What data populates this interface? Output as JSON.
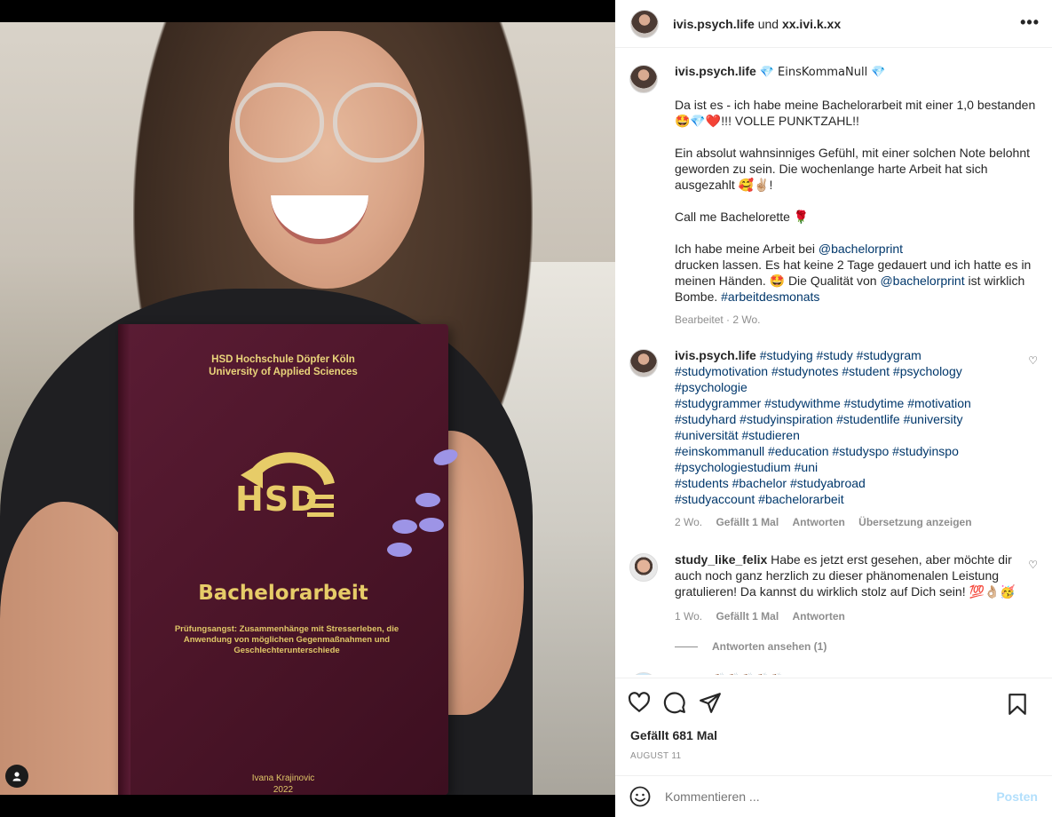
{
  "photo": {
    "book": {
      "university": "HSD Hochschule Döpfer Köln",
      "university_sub": "University of Applied Sciences",
      "logo_text": "HSD",
      "title": "Bachelorarbeit",
      "topic": "Prüfungsangst: Zusammenhänge mit Stresserleben, die Anwendung von möglichen Gegenmaßnahmen und Geschlechterunterschiede",
      "author": "Ivana Krajinovic",
      "year": "2022"
    }
  },
  "header": {
    "username": "ivis.psych.life",
    "connector": "und",
    "collaborator": "xx.ivi.k.xx",
    "more_label": "•••"
  },
  "caption": {
    "username": "ivis.psych.life",
    "title": "💎 EinsKommaNull 💎",
    "p1": "Da ist es - ich habe meine Bachelorarbeit mit einer 1,0 bestanden 🤩💎❤️!!! VOLLE PUNKTZAHL!!",
    "p2": "Ein absolut wahnsinniges Gefühl, mit einer solchen Note belohnt geworden zu sein. Die wochenlange harte Arbeit hat sich ausgezahlt 🥰✌🏼!",
    "p3": "Call me Bachelorette 🌹",
    "p4_a": "Ich habe meine Arbeit bei",
    "p4_mention1": "@bachelorprint",
    "p4_b": "drucken lassen. Es hat keine 2 Tage gedauert und ich hatte es in meinen Händen. 🤩 Die Qualität von",
    "p4_mention2": "@bachelorprint",
    "p4_c": "ist wirklich Bombe.",
    "p4_tag": "#arbeitdesmonats",
    "meta": "Bearbeitet · 2 Wo."
  },
  "comment1": {
    "username": "ivis.psych.life",
    "tags_line1": "#studying #study #studygram",
    "tags_line2": "#studymotivation #studynotes #student #psychology",
    "tags_line3": "#psychologie",
    "tags_line4": "#studygrammer #studywithme #studytime #motivation",
    "tags_line5": "#studyhard #studyinspiration #studentlife #university",
    "tags_line6": "#universität #studieren",
    "tags_line7": "#einskommanull #education #studyspo #studyinspo",
    "tags_line8": "#psychologiestudium #uni",
    "tags_line9": "#students #bachelor #studyabroad",
    "tags_line10": "#studyaccount #bachelorarbeit",
    "time": "2 Wo.",
    "likes": "Gefällt 1 Mal",
    "reply": "Antworten",
    "translate": "Übersetzung anzeigen"
  },
  "comment2": {
    "username": "study_like_felix",
    "text": "Habe es jetzt erst gesehen, aber möchte dir auch noch ganz herzlich zu dieser phänomenalen Leistung gratulieren! Da kannst du wirklich stolz auf Dich sein! 💯👌🏼🥳",
    "time": "1 Wo.",
    "likes": "Gefällt 1 Mal",
    "reply": "Antworten",
    "view_replies": "Antworten ansehen (1)"
  },
  "comment3_peek": "👏🏾👏🏾👏🏾👏🏾👏🏾",
  "post": {
    "likes": "Gefällt 681 Mal",
    "date": "AUGUST 11"
  },
  "composer": {
    "placeholder": "Kommentieren ...",
    "post_label": "Posten"
  }
}
